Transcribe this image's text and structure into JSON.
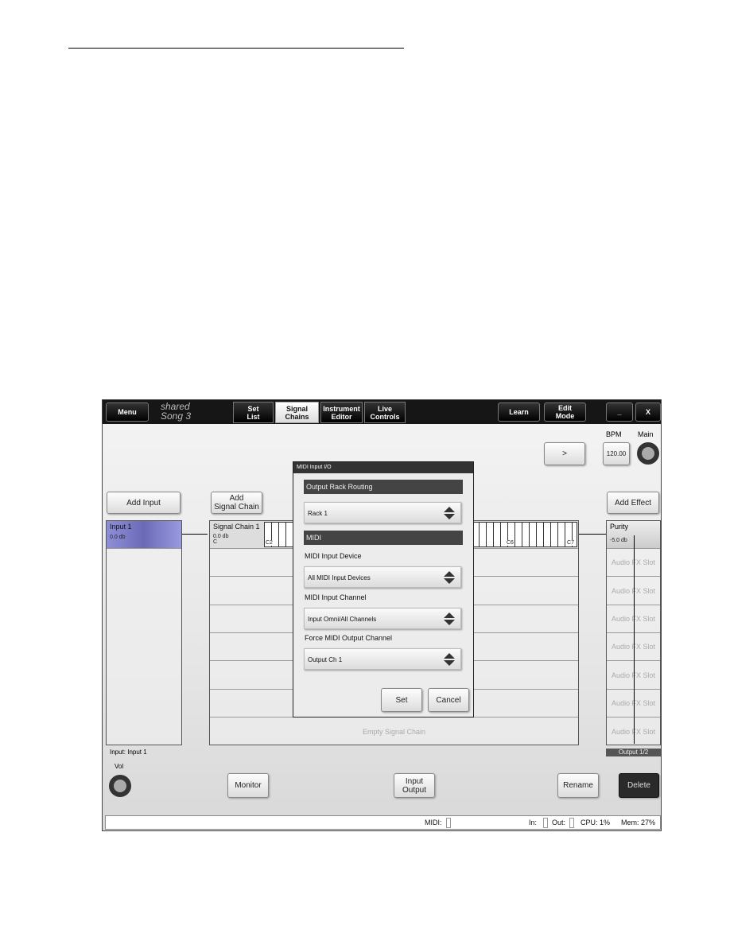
{
  "topbar": {
    "menu": "Menu",
    "song_folder": "shared",
    "song_name": "Song 3",
    "tabs": [
      "Set\nList",
      "Signal\nChains",
      "Instrument\nEditor",
      "Live\nControls"
    ],
    "selected_tab": "Signal Chains",
    "learn": "Learn",
    "edit_mode": "Edit\nMode",
    "minimize": "_",
    "close": "X"
  },
  "transport": {
    "next": ">",
    "bpm_label": "BPM",
    "bpm": "120.00",
    "main_label": "Main"
  },
  "inputs": {
    "add_label": "Add Input",
    "item_name": "Input 1",
    "item_level": "0.0 db",
    "footer": "Input: Input 1",
    "vol_label": "Vol"
  },
  "chains": {
    "add_label": "Add\nSignal Chain",
    "chain_name": "Signal Chain 1",
    "chain_level": "0.0 db",
    "chain_key": "C",
    "key_low": "C2",
    "key_mid": "C6",
    "key_high": "C7",
    "empty_label": "Empty Signal Chain"
  },
  "effects": {
    "add_label": "Add Effect",
    "effect_name": "Purity",
    "effect_level": "-5.0 db",
    "slot_label": "Audio FX Slot",
    "output_label": "Output 1/2"
  },
  "dialog": {
    "title": "MIDI Input I/O",
    "section1": "Output Rack Routing",
    "rack": "Rack 1",
    "section2": "MIDI",
    "input_device_label": "MIDI Input Device",
    "input_device": "All MIDI Input Devices",
    "input_channel_label": "MIDI Input Channel",
    "input_channel": "Input Omni/All Channels",
    "force_output_label": "Force MIDI Output Channel",
    "force_output": "Output Ch 1",
    "set": "Set",
    "cancel": "Cancel"
  },
  "bottom": {
    "monitor": "Monitor",
    "input_output": "Input\nOutput",
    "rename": "Rename",
    "delete": "Delete"
  },
  "status": {
    "midi": "MIDI:",
    "in": "In:",
    "out": "Out:",
    "cpu": "CPU: 1%",
    "mem": "Mem: 27%"
  }
}
